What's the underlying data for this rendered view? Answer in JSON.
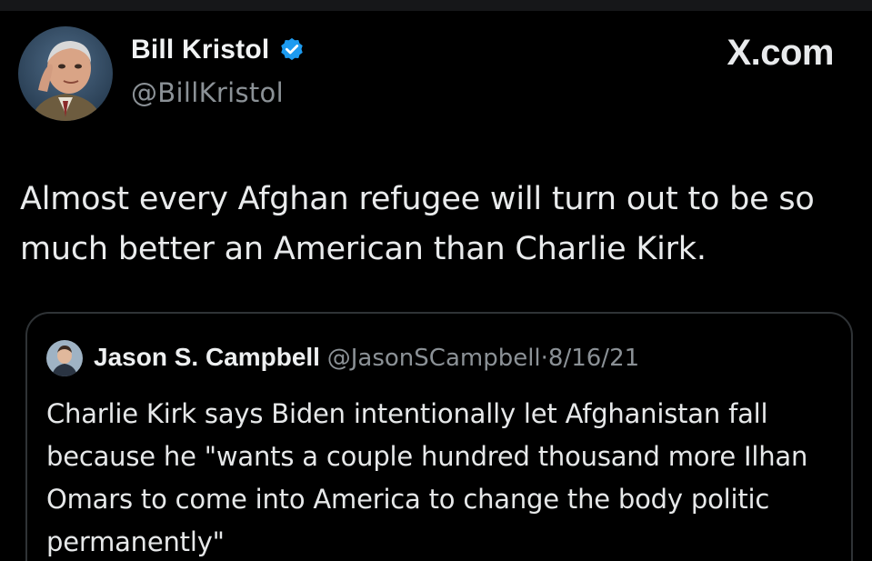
{
  "author": {
    "display_name": "Bill Kristol",
    "handle": "@BillKristol",
    "verified": true
  },
  "brand": {
    "label": "X.com"
  },
  "tweet": {
    "text": "Almost every Afghan refugee will turn out to be so much better an American than Charlie Kirk."
  },
  "quoted_tweet": {
    "display_name": "Jason S. Campbell",
    "handle": "@JasonSCampbell",
    "separator": "·",
    "date": "8/16/21",
    "text": "Charlie Kirk says Biden intentionally let Afghanistan fall because he \"wants a couple hundred thousand more Ilhan Omars to come into America to change the body politic permanently\""
  },
  "colors": {
    "background": "#000000",
    "verified_badge": "#1d9bf0",
    "secondary_text": "#8b9196",
    "card_border": "#2f3336"
  },
  "icons": {
    "verified": "verified-badge-icon"
  }
}
